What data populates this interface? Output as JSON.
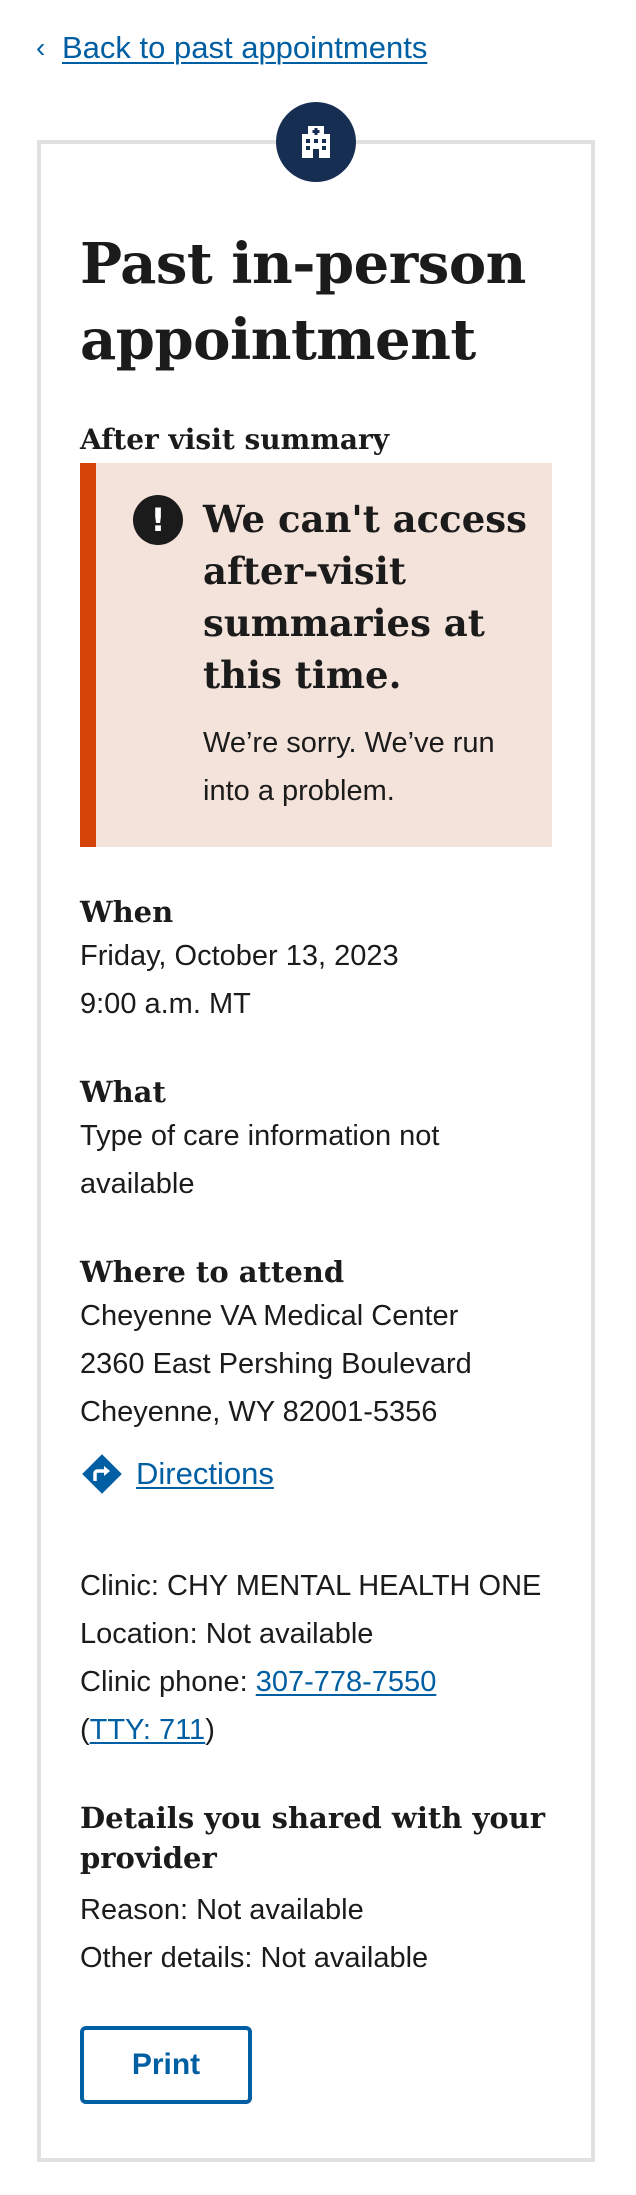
{
  "back_link": {
    "label": "Back to past appointments",
    "chevron": "‹"
  },
  "header": {
    "icon": "building-icon",
    "title": "Past in-person appointment"
  },
  "after_visit": {
    "heading": "After visit summary",
    "alert": {
      "icon": "exclamation-icon",
      "heading": "We can't access after-visit summaries at this time.",
      "body": "We’re sorry. We’ve run into a problem."
    }
  },
  "when": {
    "heading": "When",
    "date": "Friday, October 13, 2023",
    "time": "9:00 a.m. MT"
  },
  "what": {
    "heading": "What",
    "value": "Type of care information not available"
  },
  "where": {
    "heading": "Where to attend",
    "facility": "Cheyenne VA Medical Center",
    "street": "2360 East Pershing Boulevard",
    "city": "Cheyenne, WY 82001-5356",
    "directions_label": "Directions",
    "directions_icon": "directions-icon"
  },
  "clinic": {
    "clinic_line": "Clinic: CHY MENTAL HEALTH ONE",
    "location_line": "Location: Not available",
    "phone_prefix": "Clinic phone: ",
    "phone": "307-778-7550",
    "tty_open": "(",
    "tty": "TTY: 711",
    "tty_close": ")"
  },
  "details": {
    "heading": "Details you shared with your provider",
    "reason": "Reason: Not available",
    "other": "Other details: Not available"
  },
  "actions": {
    "print_label": "Print"
  },
  "colors": {
    "link": "#005ea2",
    "navy": "#162e51",
    "alert_bg": "#f4e3db",
    "alert_border": "#d54309",
    "card_border": "#dfe1e2"
  }
}
